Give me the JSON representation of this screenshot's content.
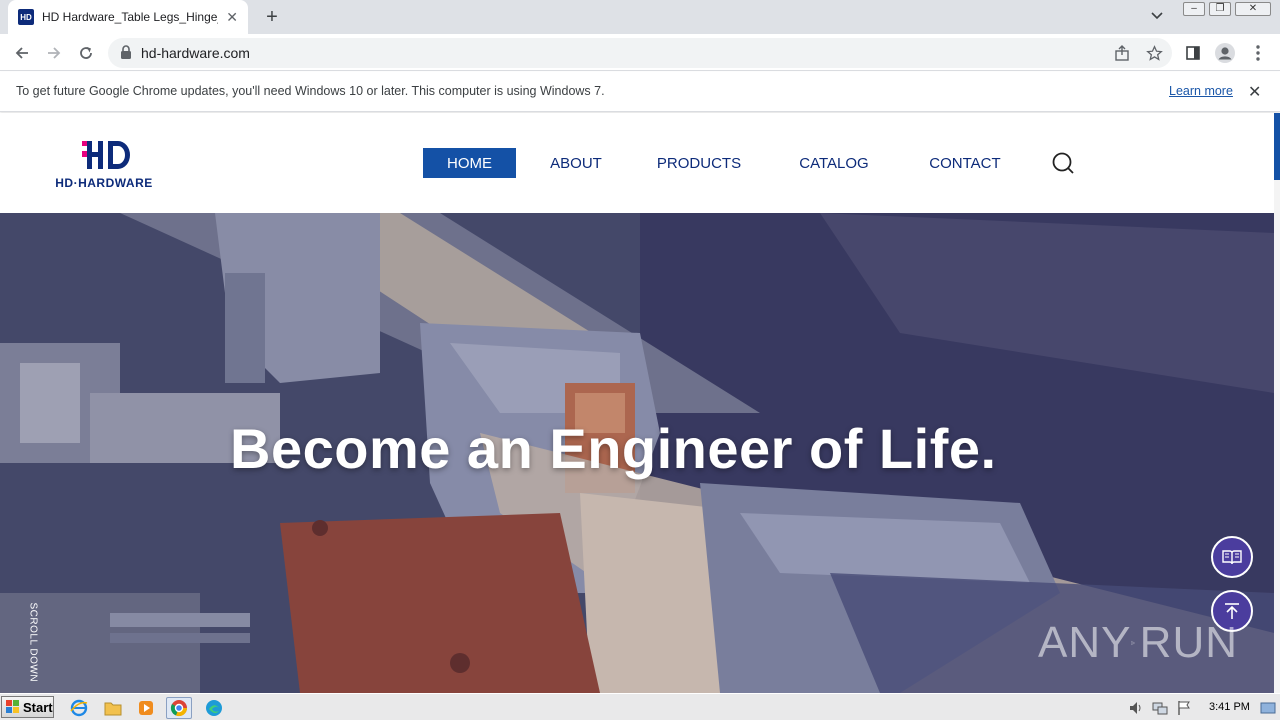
{
  "browser": {
    "tab_title": "HD Hardware_Table Legs_Hinge_Met",
    "tab_favicon_text": "HD",
    "url": "hd-hardware.com"
  },
  "infobar": {
    "message": "To get future Google Chrome updates, you'll need Windows 10 or later. This computer is using Windows 7.",
    "learn_more": "Learn more"
  },
  "site": {
    "logo_text": "HD·HARDWARE",
    "brand_colors": {
      "navy": "#0d2b7a",
      "magenta": "#e6007e",
      "nav_active": "#1451a6",
      "fab": "#4b3d9e"
    },
    "nav": [
      {
        "label": "HOME",
        "active": true
      },
      {
        "label": "ABOUT",
        "active": false
      },
      {
        "label": "PRODUCTS",
        "active": false
      },
      {
        "label": "CATALOG",
        "active": false
      },
      {
        "label": "CONTACT",
        "active": false
      }
    ],
    "search_icon": "search-icon"
  },
  "hero": {
    "headline": "Become an Engineer of Life.",
    "scroll_hint": "SCROLL DOWN",
    "fabs": [
      "catalog-book-icon",
      "back-to-top-icon"
    ]
  },
  "watermark": {
    "left": "ANY",
    "right": "RUN"
  },
  "taskbar": {
    "start_label": "Start",
    "clock": "3:41 PM"
  }
}
